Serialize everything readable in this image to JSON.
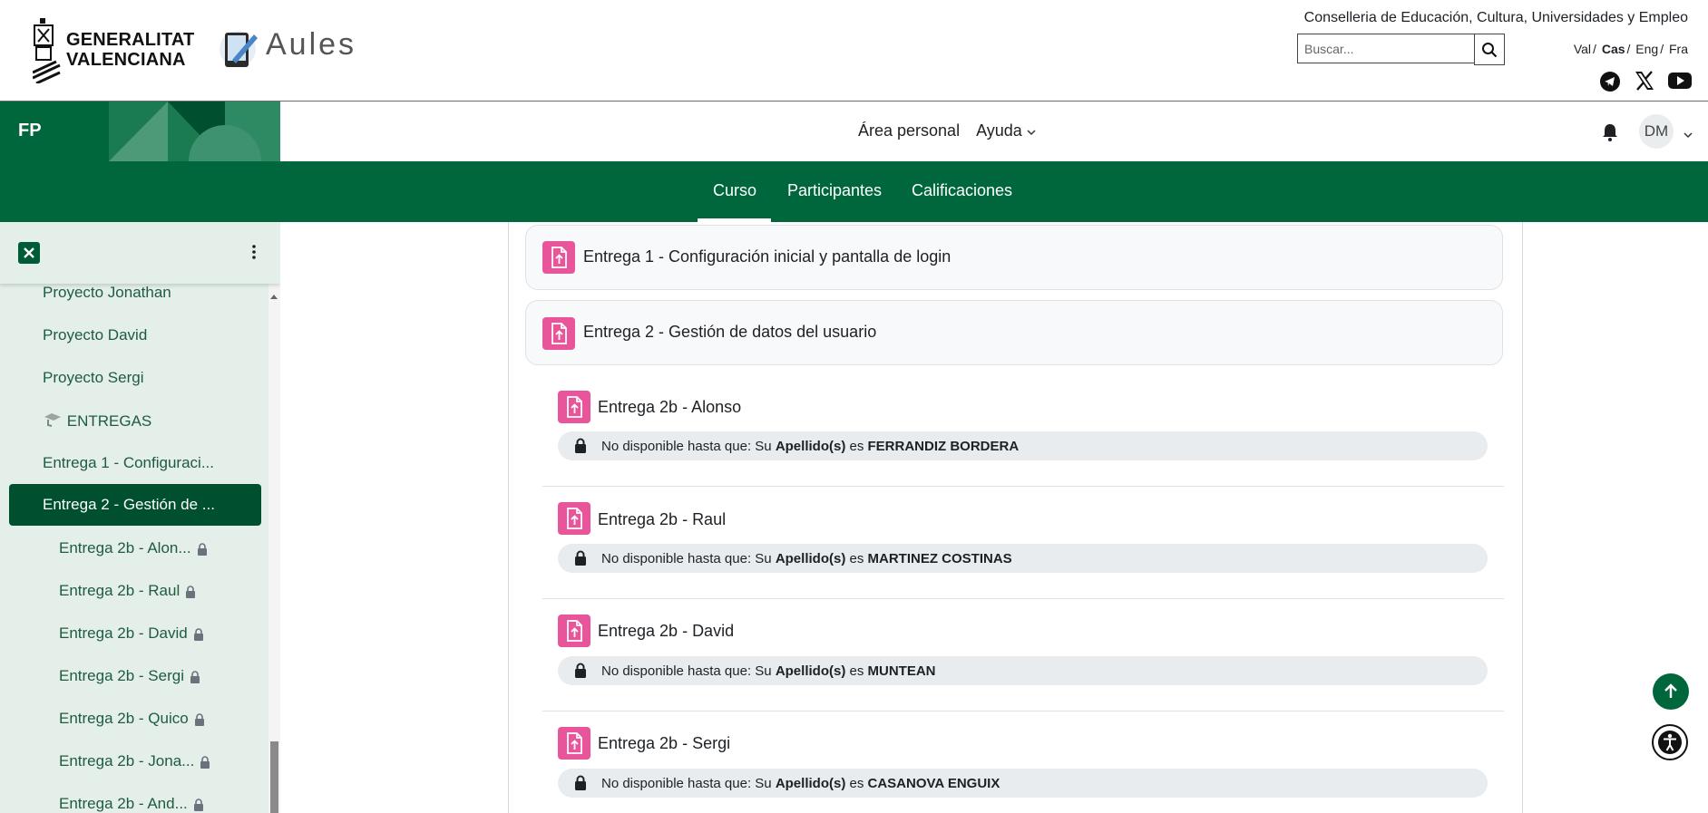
{
  "header": {
    "brand_line1": "GENERALITAT",
    "brand_line2": "VALENCIANA",
    "app_name": "Aules",
    "conselleria": "Conselleria de Educación, Cultura, Universidades y Empleo",
    "search_placeholder": "Buscar...",
    "languages": [
      {
        "label": "Val",
        "active": false
      },
      {
        "label": "Cas",
        "active": true
      },
      {
        "label": "Eng",
        "active": false
      },
      {
        "label": "Fra",
        "active": false
      }
    ],
    "social_icons": [
      "telegram-icon",
      "x-icon",
      "youtube-icon"
    ]
  },
  "navbar": {
    "course_short": "FP",
    "links": [
      "Área personal",
      "Ayuda"
    ],
    "user_initials": "DM"
  },
  "secondary_nav": {
    "tabs": [
      "Curso",
      "Participantes",
      "Calificaciones"
    ],
    "active": "Curso"
  },
  "sidebar": {
    "items": [
      {
        "label": "Proyecto Jonathan"
      },
      {
        "label": "Proyecto David"
      },
      {
        "label": "Proyecto Sergi"
      },
      {
        "label": "ENTREGAS"
      },
      {
        "label": "Entrega 1 - Configuraci..."
      },
      {
        "label": "Entrega 2 - Gestión de ..."
      },
      {
        "label": "Entrega 2b - Alon..."
      },
      {
        "label": "Entrega 2b - Raul"
      },
      {
        "label": "Entrega 2b - David"
      },
      {
        "label": "Entrega 2b - Sergi"
      },
      {
        "label": "Entrega 2b - Quico"
      },
      {
        "label": "Entrega 2b - Jona..."
      },
      {
        "label": "Entrega 2b - And..."
      }
    ]
  },
  "main": {
    "activities": [
      {
        "title": "Entrega 1 - Configuración inicial y pantalla de login"
      },
      {
        "title": "Entrega 2 - Gestión de datos del usuario"
      }
    ],
    "restriction_prefix": "No disponible hasta que: Su",
    "restriction_field": "Apellido(s)",
    "restriction_verb": "es",
    "subactivities": [
      {
        "title": "Entrega 2b - Alonso",
        "value": "FERRANDIZ BORDERA"
      },
      {
        "title": "Entrega 2b - Raul",
        "value": "MARTINEZ COSTINAS"
      },
      {
        "title": "Entrega 2b - David",
        "value": "MUNTEAN"
      },
      {
        "title": "Entrega 2b - Sergi",
        "value": "CASANOVA ENGUIX"
      }
    ]
  },
  "colors": {
    "primary_green": "#00673c",
    "assign_pink": "#e8559b",
    "sidebar_bg": "#e4efe9"
  }
}
